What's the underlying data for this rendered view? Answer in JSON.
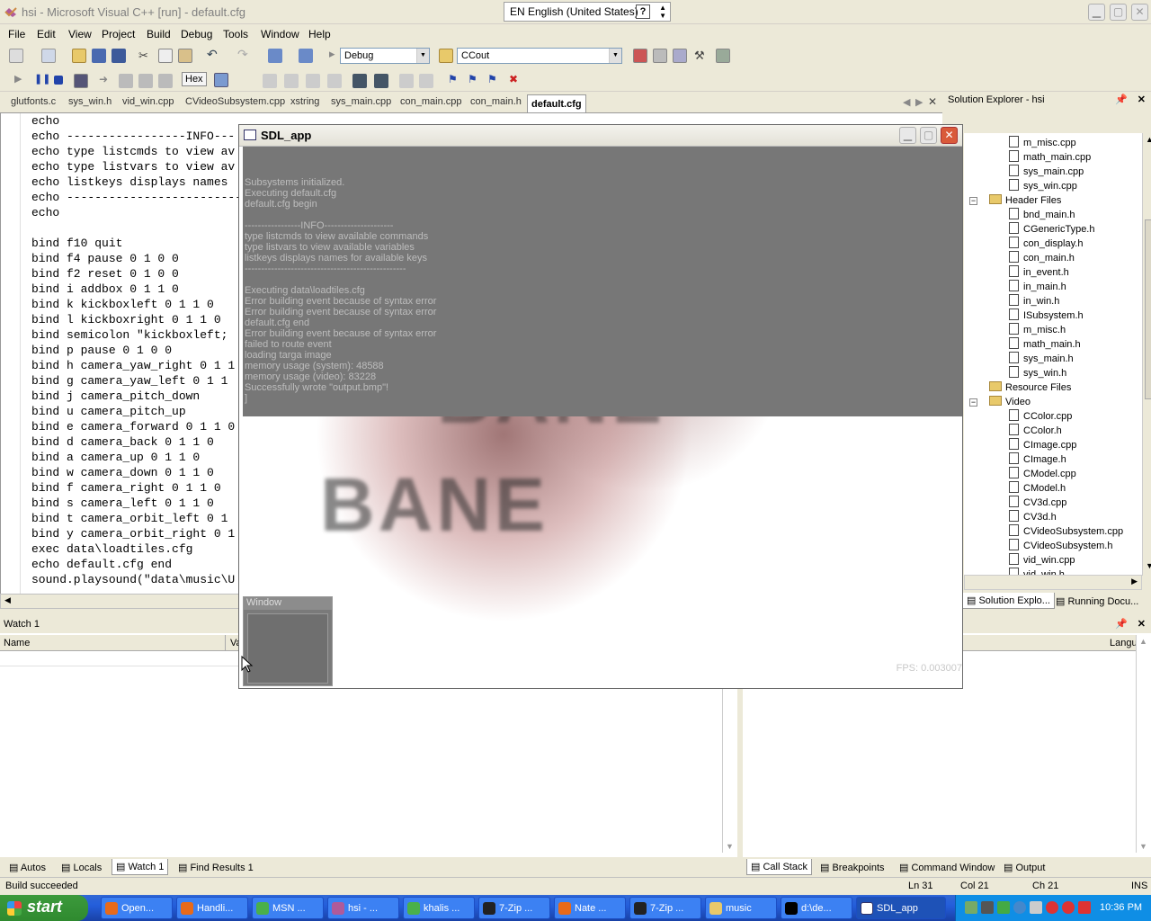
{
  "window": {
    "title": "hsi - Microsoft Visual C++ [run] - default.cfg",
    "language": "EN English (United States)",
    "help_glyph": "?"
  },
  "menu": [
    "File",
    "Edit",
    "View",
    "Project",
    "Build",
    "Debug",
    "Tools",
    "Window",
    "Help"
  ],
  "toolbar": {
    "config_value": "Debug",
    "target_value": "CCout",
    "hex_label": "Hex"
  },
  "tabs": [
    "glutfonts.c",
    "sys_win.h",
    "vid_win.cpp",
    "CVideoSubsystem.cpp",
    "xstring",
    "sys_main.cpp",
    "con_main.cpp",
    "con_main.h",
    "default.cfg"
  ],
  "editor": {
    "lines": [
      "echo",
      "echo -----------------INFO---",
      "echo type listcmds to view av",
      "echo type listvars to view av",
      "echo listkeys displays names ",
      "echo ---------------------------",
      "echo",
      "",
      "bind f10 quit",
      "bind f4 pause 0 1 0 0",
      "bind f2 reset 0 1 0 0",
      "bind i addbox 0 1 1 0",
      "bind k kickboxleft 0 1 1 0",
      "bind l kickboxright 0 1 1 0",
      "bind semicolon \"kickboxleft;",
      "bind p pause 0 1 0 0",
      "bind h camera_yaw_right 0 1 1",
      "bind g camera_yaw_left 0 1 1",
      "bind j camera_pitch_down",
      "bind u camera_pitch_up",
      "bind e camera_forward 0 1 1 0",
      "bind d camera_back 0 1 1 0",
      "bind a camera_up 0 1 1 0",
      "bind w camera_down 0 1 1 0",
      "bind f camera_right 0 1 1 0",
      "bind s camera_left 0 1 1 0",
      "bind t camera_orbit_left 0 1",
      "bind y camera_orbit_right 0 1",
      "exec data\\loadtiles.cfg",
      "echo default.cfg end",
      "sound.playsound(\"data\\music\\U"
    ]
  },
  "solution_explorer": {
    "title": "Solution Explorer - hsi",
    "items": [
      {
        "label": "m_misc.cpp",
        "kind": "file"
      },
      {
        "label": "math_main.cpp",
        "kind": "file"
      },
      {
        "label": "sys_main.cpp",
        "kind": "file"
      },
      {
        "label": "sys_win.cpp",
        "kind": "file"
      },
      {
        "label": "Header Files",
        "kind": "folder"
      },
      {
        "label": "bnd_main.h",
        "kind": "file"
      },
      {
        "label": "CGenericType.h",
        "kind": "file"
      },
      {
        "label": "con_display.h",
        "kind": "file"
      },
      {
        "label": "con_main.h",
        "kind": "file"
      },
      {
        "label": "in_event.h",
        "kind": "file"
      },
      {
        "label": "in_main.h",
        "kind": "file"
      },
      {
        "label": "in_win.h",
        "kind": "file"
      },
      {
        "label": "ISubsystem.h",
        "kind": "file"
      },
      {
        "label": "m_misc.h",
        "kind": "file"
      },
      {
        "label": "math_main.h",
        "kind": "file"
      },
      {
        "label": "sys_main.h",
        "kind": "file"
      },
      {
        "label": "sys_win.h",
        "kind": "file"
      },
      {
        "label": "Resource Files",
        "kind": "folder"
      },
      {
        "label": "Video",
        "kind": "folder"
      },
      {
        "label": "CColor.cpp",
        "kind": "file"
      },
      {
        "label": "CColor.h",
        "kind": "file"
      },
      {
        "label": "CImage.cpp",
        "kind": "file"
      },
      {
        "label": "CImage.h",
        "kind": "file"
      },
      {
        "label": "CModel.cpp",
        "kind": "file"
      },
      {
        "label": "CModel.h",
        "kind": "file"
      },
      {
        "label": "CV3d.cpp",
        "kind": "file"
      },
      {
        "label": "CV3d.h",
        "kind": "file"
      },
      {
        "label": "CVideoSubsystem.cpp",
        "kind": "file"
      },
      {
        "label": "CVideoSubsystem.h",
        "kind": "file"
      },
      {
        "label": "vid_win.cpp",
        "kind": "file"
      },
      {
        "label": "vid_win.h",
        "kind": "file"
      }
    ],
    "tabs": [
      "Solution Explo...",
      "Running Docu..."
    ]
  },
  "watch": {
    "title": "Watch 1",
    "columns": [
      "Name",
      "Va"
    ],
    "tabs": [
      "Autos",
      "Locals",
      "Watch 1",
      "Find Results 1"
    ]
  },
  "callstack": {
    "column": "Langu",
    "tabs": [
      "Call Stack",
      "Breakpoints",
      "Command Window",
      "Output"
    ]
  },
  "sdl": {
    "title": "SDL_app",
    "console": "Subsystems initialized.\nExecuting default.cfg\ndefault.cfg begin\n\n-----------------INFO---------------------\ntype listcmds to view available commands\ntype listvars to view available variables\nlistkeys displays names for available keys\n-------------------------------------------------\n\nExecuting data\\loadtiles.cfg\nError building event because of syntax error\nError building event because of syntax error\ndefault.cfg end\nError building event because of syntax error\nfailed to route event\nloading targa image\nmemory usage (system): 48588\nmemory usage (video): 83228\nSuccessfully wrote \"output.bmp\"!\n]",
    "logo_text_1": "BANE",
    "logo_text_2": "BANE",
    "inner_window_title": "Window",
    "fps": "FPS: 0.003007"
  },
  "status": {
    "message": "Build succeeded",
    "ln": "Ln 31",
    "col": "Col 21",
    "ch": "Ch 21",
    "ins": "INS"
  },
  "taskbar": {
    "start": "start",
    "items": [
      "Open...",
      "Handli...",
      "MSN ...",
      "hsi - ...",
      "khalis ...",
      "7-Zip ...",
      "Nate ...",
      "7-Zip ...",
      "music",
      "d:\\de...",
      "SDL_app"
    ],
    "clock": "10:36 PM"
  }
}
